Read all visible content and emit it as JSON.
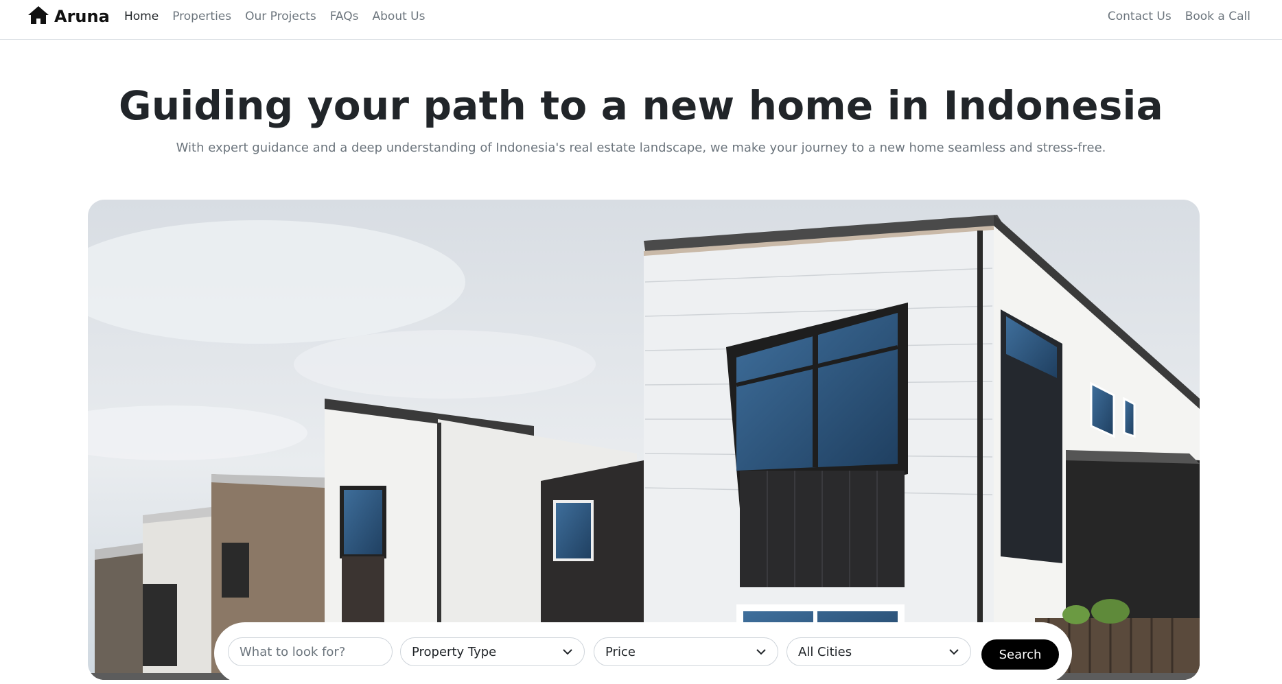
{
  "brand": {
    "name": "Aruna",
    "icon": "home-icon"
  },
  "nav": {
    "left": [
      {
        "label": "Home",
        "active": true
      },
      {
        "label": "Properties",
        "active": false
      },
      {
        "label": "Our Projects",
        "active": false
      },
      {
        "label": "FAQs",
        "active": false
      },
      {
        "label": "About Us",
        "active": false
      }
    ],
    "right": [
      {
        "label": "Contact Us"
      },
      {
        "label": "Book a Call"
      }
    ]
  },
  "hero": {
    "title": "Guiding your path to a new home in Indonesia",
    "subtitle": "With expert guidance and a deep understanding of Indonesia's real estate landscape, we make your journey to a new home seamless and stress-free."
  },
  "search": {
    "input_placeholder": "What to look for?",
    "property_type": "Property Type",
    "price": "Price",
    "city": "All Cities",
    "button_label": "Search"
  },
  "colors": {
    "accent": "#000000",
    "text_primary": "#212529",
    "text_muted": "#6c757d",
    "border": "#dee2e6"
  }
}
